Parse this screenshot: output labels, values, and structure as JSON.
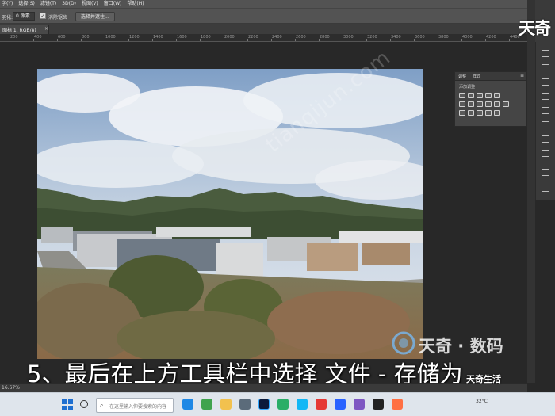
{
  "menu": {
    "items": [
      "字(Y)",
      "选择(S)",
      "滤镜(T)",
      "3D(D)",
      "视图(V)",
      "窗口(W)",
      "帮助(H)"
    ]
  },
  "options": {
    "feather_label": "羽化:",
    "feather_value": "0 像素",
    "antialias_label": "消除锯齿",
    "select_mask_label": "选择并遮住..."
  },
  "document_tab": {
    "label": "图标 1, RGB/8)",
    "close": "×"
  },
  "ruler": {
    "ticks": [
      "200",
      "400",
      "600",
      "800",
      "1000",
      "1200",
      "1400",
      "1600",
      "1800",
      "2000",
      "2200",
      "2400",
      "2600",
      "2800",
      "3000",
      "3200",
      "3400",
      "3600",
      "3800",
      "4000",
      "4200",
      "4400"
    ]
  },
  "panel": {
    "tab_adjust": "调整",
    "tab_style": "样式",
    "menu_glyph": "≡",
    "subtitle": "添加调整"
  },
  "photo_watermark": "tianqijun.com",
  "corner_logo": "天奇",
  "brand_watermark": "天奇 · 数码",
  "caption": "5、最后在上方工具栏中选择 文件 - 存储为",
  "status": {
    "left": "16.67%"
  },
  "taskbar": {
    "search_placeholder": "在这里输入你要搜索的内容",
    "temperature": "32°C",
    "tray_overlay": "天奇生活"
  },
  "colors": {
    "ps_panel": "#535353",
    "ps_canvas": "#282828",
    "taskbar": "#dfe5ec"
  }
}
